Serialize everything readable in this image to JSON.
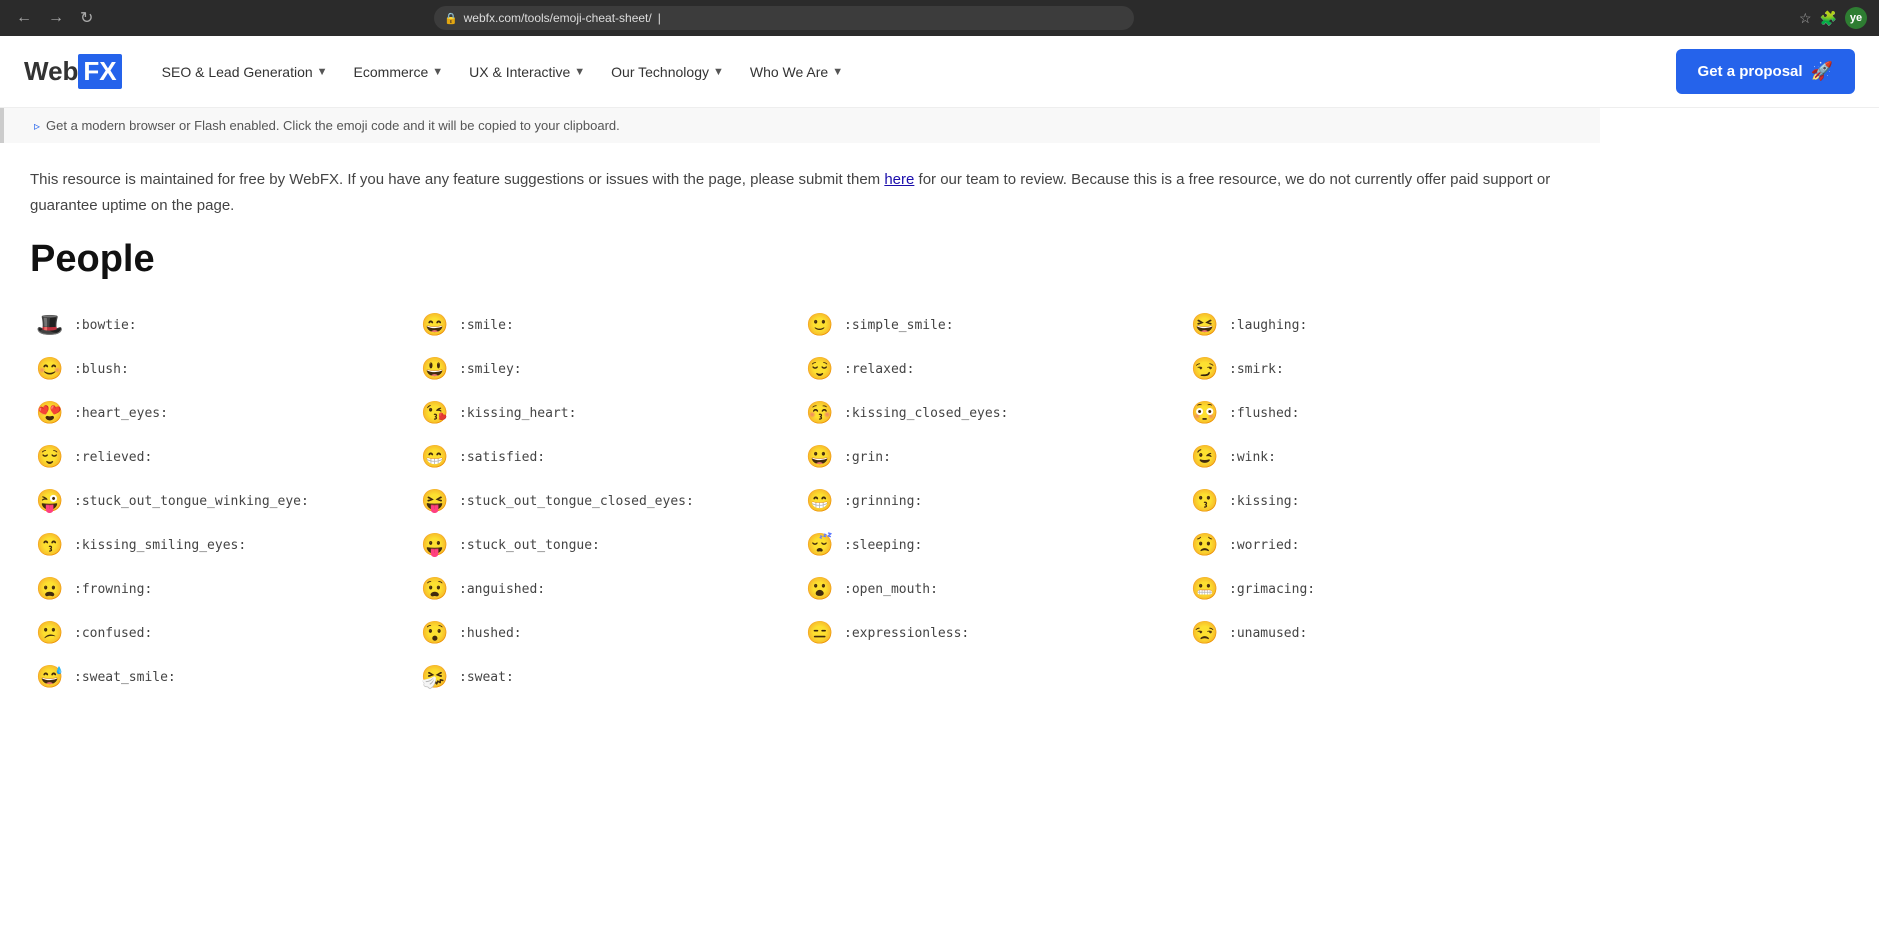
{
  "browser": {
    "url": "webfx.com/tools/emoji-cheat-sheet/",
    "cursor": "|",
    "back_label": "←",
    "forward_label": "→",
    "refresh_label": "↻",
    "star_label": "☆",
    "puzzle_label": "🧩",
    "avatar_label": "ye",
    "lock_icon": "🔒"
  },
  "navbar": {
    "logo_web": "Web",
    "logo_fx": "FX",
    "nav_items": [
      {
        "label": "SEO & Lead Generation",
        "has_chevron": true
      },
      {
        "label": "Ecommerce",
        "has_chevron": true
      },
      {
        "label": "UX & Interactive",
        "has_chevron": true
      },
      {
        "label": "Our Technology",
        "has_chevron": true
      },
      {
        "label": "Who We Are",
        "has_chevron": true
      }
    ],
    "cta_label": "Get a proposal",
    "cta_rocket": "🚀"
  },
  "info_bar": {
    "text": "Get a modern browser or Flash enabled. Click the emoji code and it will be copied to your clipboard."
  },
  "resource_notice": {
    "text_before": "This resource is maintained for free by WebFX. If you have any feature suggestions or issues with the page, please submit them ",
    "link_text": "here",
    "text_after": " for our team to review. Because this is a free resource, we do not currently offer paid support or guarantee uptime on the page."
  },
  "section": {
    "title": "People"
  },
  "emojis": [
    {
      "char": "🎩",
      "code": ":bowtie:"
    },
    {
      "char": "😄",
      "code": ":smile:"
    },
    {
      "char": "🙂",
      "code": ":simple_smile:"
    },
    {
      "char": "😆",
      "code": ":laughing:"
    },
    {
      "char": "😊",
      "code": ":blush:"
    },
    {
      "char": "😃",
      "code": ":smiley:"
    },
    {
      "char": "😌",
      "code": ":relaxed:"
    },
    {
      "char": "😏",
      "code": ":smirk:"
    },
    {
      "char": "😍",
      "code": ":heart_eyes:"
    },
    {
      "char": "😘",
      "code": ":kissing_heart:"
    },
    {
      "char": "😚",
      "code": ":kissing_closed_eyes:"
    },
    {
      "char": "😳",
      "code": ":flushed:"
    },
    {
      "char": "😌",
      "code": ":relieved:"
    },
    {
      "char": "😁",
      "code": ":satisfied:"
    },
    {
      "char": "😀",
      "code": ":grin:"
    },
    {
      "char": "😉",
      "code": ":wink:"
    },
    {
      "char": "😜",
      "code": ":stuck_out_tongue_winking_eye:"
    },
    {
      "char": "😝",
      "code": ":stuck_out_tongue_closed_eyes:"
    },
    {
      "char": "😁",
      "code": ":grinning:"
    },
    {
      "char": "😗",
      "code": ":kissing:"
    },
    {
      "char": "😙",
      "code": ":kissing_smiling_eyes:"
    },
    {
      "char": "😛",
      "code": ":stuck_out_tongue:"
    },
    {
      "char": "😴",
      "code": ":sleeping:"
    },
    {
      "char": "😟",
      "code": ":worried:"
    },
    {
      "char": "😦",
      "code": ":frowning:"
    },
    {
      "char": "😧",
      "code": ":anguished:"
    },
    {
      "char": "😮",
      "code": ":open_mouth:"
    },
    {
      "char": "😬",
      "code": ":grimacing:"
    },
    {
      "char": "😕",
      "code": ":confused:"
    },
    {
      "char": "😯",
      "code": ":hushed:"
    },
    {
      "char": "😑",
      "code": ":expressionless:"
    },
    {
      "char": "😒",
      "code": ":unamused:"
    },
    {
      "char": "😅",
      "code": ":sweat_smile:"
    },
    {
      "char": "🤧",
      "code": ":sweat:"
    }
  ]
}
